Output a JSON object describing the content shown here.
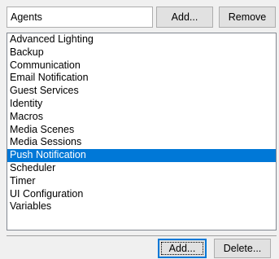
{
  "header": {
    "label": "Agents",
    "add_label": "Add...",
    "remove_label": "Remove"
  },
  "list": {
    "items": [
      {
        "label": "Advanced Lighting",
        "selected": false
      },
      {
        "label": "Backup",
        "selected": false
      },
      {
        "label": "Communication",
        "selected": false
      },
      {
        "label": "Email Notification",
        "selected": false
      },
      {
        "label": "Guest Services",
        "selected": false
      },
      {
        "label": "Identity",
        "selected": false
      },
      {
        "label": "Macros",
        "selected": false
      },
      {
        "label": "Media Scenes",
        "selected": false
      },
      {
        "label": "Media Sessions",
        "selected": false
      },
      {
        "label": "Push Notification",
        "selected": true
      },
      {
        "label": "Scheduler",
        "selected": false
      },
      {
        "label": "Timer",
        "selected": false
      },
      {
        "label": "UI Configuration",
        "selected": false
      },
      {
        "label": "Variables",
        "selected": false
      }
    ],
    "selection_color": "#0078d7"
  },
  "footer": {
    "add_label": "Add...",
    "delete_label": "Delete..."
  }
}
